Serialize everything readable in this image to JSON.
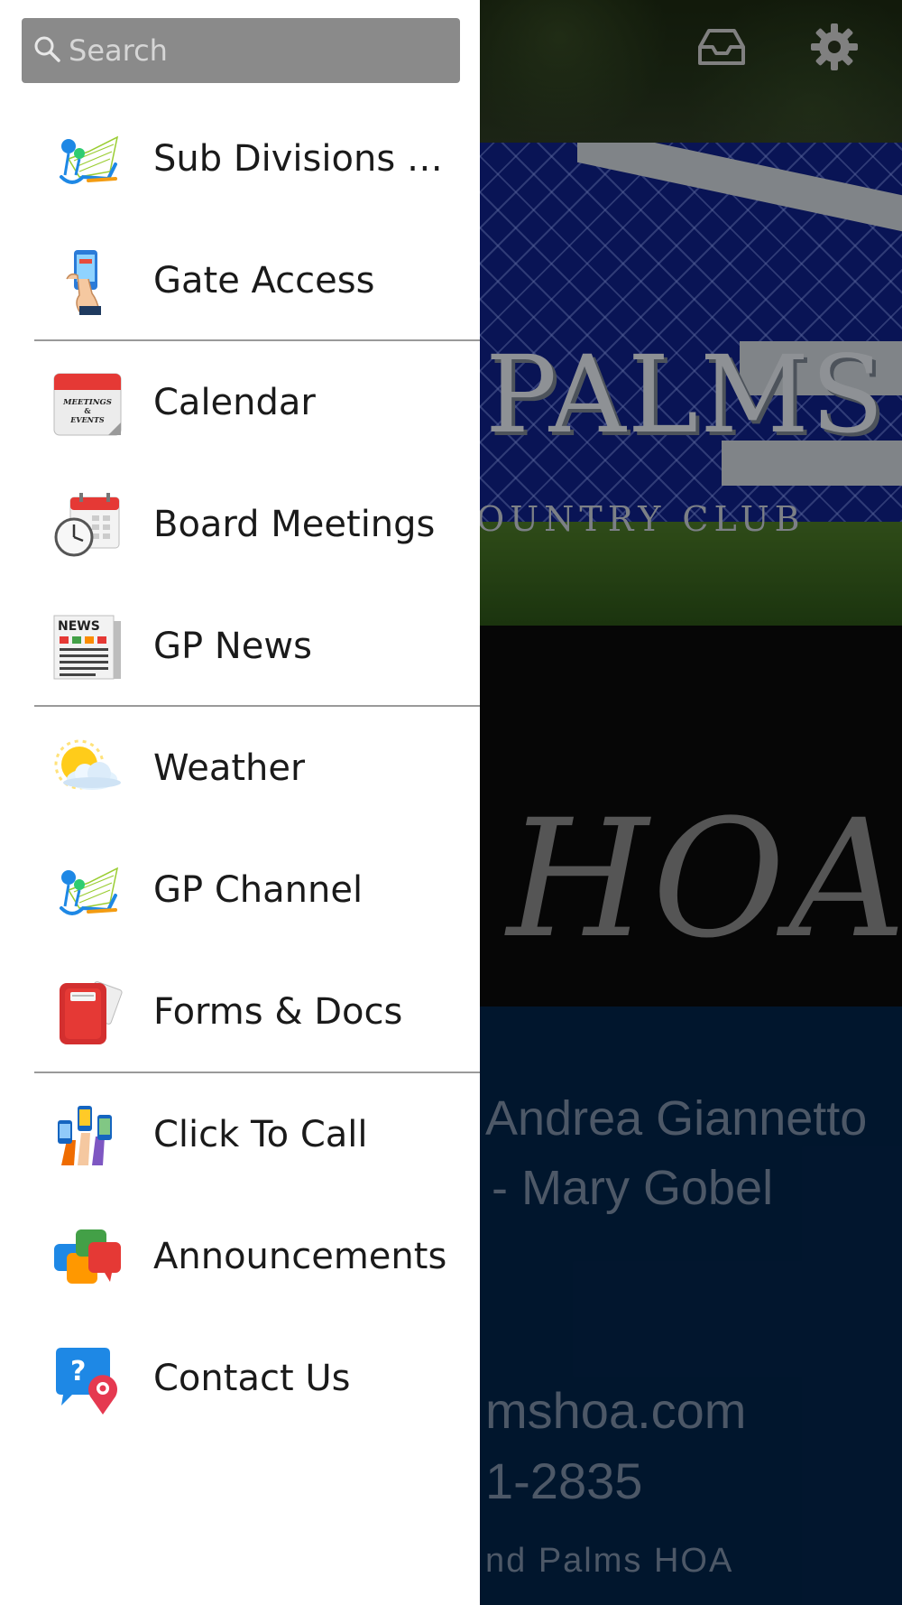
{
  "search": {
    "placeholder": "Search"
  },
  "menu": [
    {
      "label": "Sub Divisions C...",
      "icon": "sub-divisions-icon"
    },
    {
      "label": "Gate Access",
      "icon": "gate-access-phone-icon"
    },
    {
      "label": "Calendar",
      "icon": "calendar-meetings-events-icon"
    },
    {
      "label": "Board Meetings",
      "icon": "board-meetings-clock-calendar-icon"
    },
    {
      "label": "GP News",
      "icon": "newspaper-icon"
    },
    {
      "label": "Weather",
      "icon": "sun-cloud-icon"
    },
    {
      "label": "GP Channel",
      "icon": "channel-icon"
    },
    {
      "label": "Forms & Docs",
      "icon": "red-folder-icon"
    },
    {
      "label": "Click To Call",
      "icon": "hands-phones-icon"
    },
    {
      "label": "Announcements",
      "icon": "chat-bubbles-icon"
    },
    {
      "label": "Contact Us",
      "icon": "question-location-icon"
    }
  ],
  "calendar_icon_text": "MEETINGS & EVENTS",
  "news_icon_text": "NEWS",
  "background": {
    "sign_text": "PALMS",
    "sign_sub": "OUNTRY CLUB",
    "title": "HOA",
    "line_1": "Andrea Giannetto",
    "line_2": "- Mary Gobel",
    "line_3": "mshoa.com",
    "line_4": "1-2835",
    "line_5": "nd Palms HOA"
  },
  "colors": {
    "drawer_bg": "#ffffff",
    "search_bg": "#8a8a8a",
    "bg_blue": "#03244a"
  }
}
